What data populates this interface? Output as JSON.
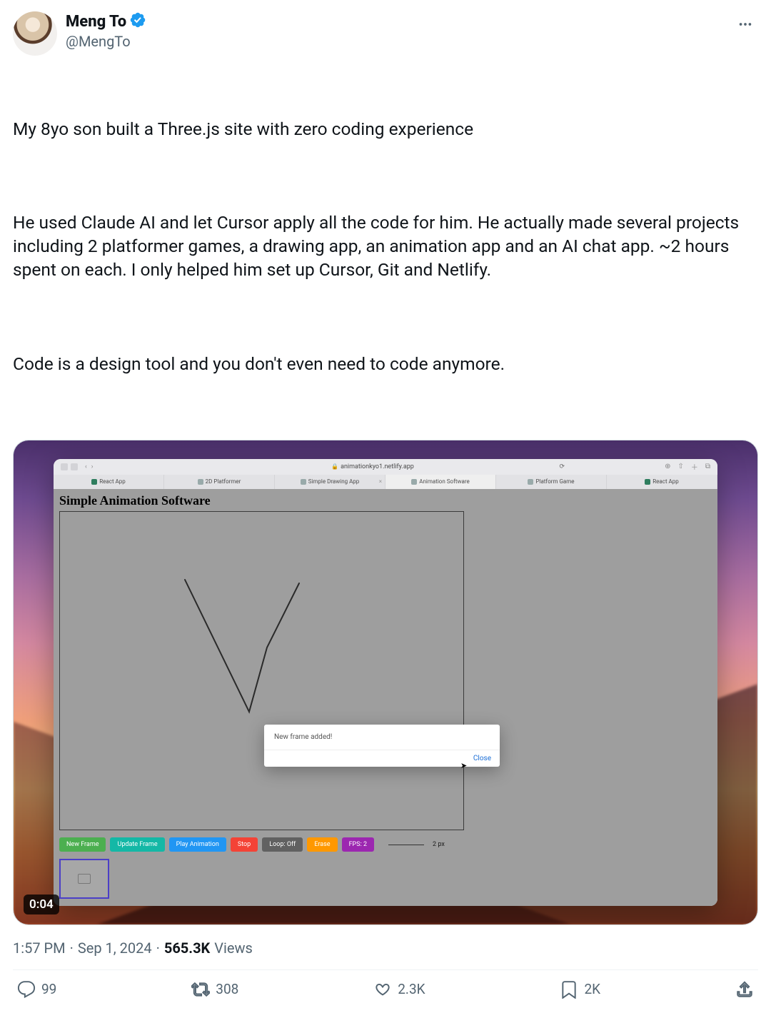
{
  "author": {
    "display_name": "Meng To",
    "handle": "@MengTo",
    "verified": true
  },
  "tweet_body": {
    "p1": "My 8yo son built a Three.js site with zero coding experience",
    "p2": "He used Claude AI and let Cursor apply all the code for him. He actually made several projects including 2 platformer games, a drawing app, an animation app and an AI chat app. ~2 hours spent on each. I only helped him set up Cursor, Git and Netlify.",
    "p3": "Code is a design tool and you don't even need to code anymore."
  },
  "video": {
    "timestamp": "0:04"
  },
  "embedded": {
    "url": "animationkyo1.netlify.app",
    "tabs": [
      "React App",
      "2D Platformer",
      "Simple Drawing App",
      "Animation Software",
      "Platform Game",
      "React App"
    ],
    "active_tab_index": 3,
    "page_title": "Simple Animation Software",
    "dialog_text": "New frame added!",
    "dialog_close": "Close",
    "toolbar": {
      "new_frame": "New Frame",
      "update_frame": "Update Frame",
      "play": "Play Animation",
      "stop": "Stop",
      "loop": "Loop: Off",
      "erase": "Erase",
      "fps": "FPS: 2",
      "px": "2",
      "px_unit": "px"
    }
  },
  "meta": {
    "time": "1:57 PM",
    "date": "Sep 1, 2024",
    "views_num": "565.3K",
    "views_label": "Views"
  },
  "actions": {
    "replies": "99",
    "retweets": "308",
    "likes": "2.3K",
    "bookmarks": "2K"
  }
}
